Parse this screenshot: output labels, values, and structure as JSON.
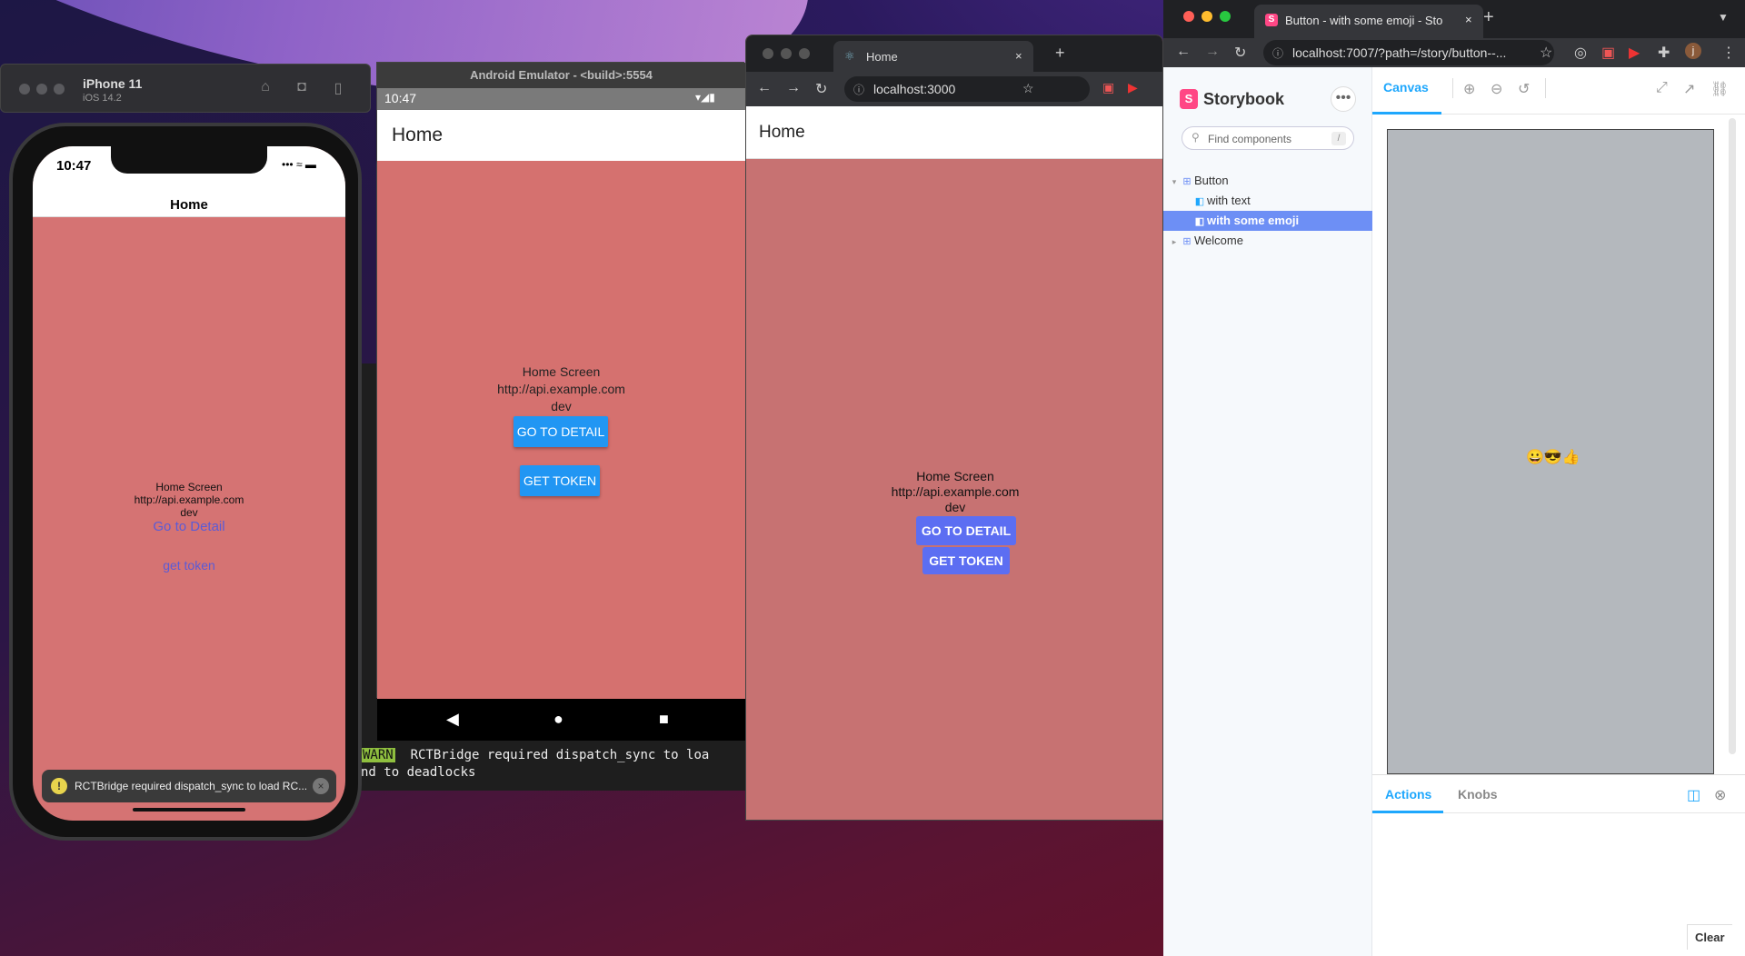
{
  "ios_sim": {
    "device_name": "iPhone 11",
    "os_version": "iOS 14.2",
    "time": "10:47",
    "status_icons": "••• ≈ ▬",
    "nav_title": "Home",
    "screen_title": "Home Screen",
    "api_url": "http://api.example.com",
    "env": "dev",
    "link_detail": "Go to Detail",
    "link_token": "get token",
    "warning": "RCTBridge required dispatch_sync to load RC..."
  },
  "terminal": {
    "lines": [
      "WARN",
      "  RCTBridge required dispatch_sync to loa",
      "nd to deadlocks"
    ]
  },
  "android": {
    "window_title": "Android Emulator - <build>:5554",
    "time": "10:47",
    "bar_title": "Home",
    "screen_title": "Home Screen",
    "api_url": "http://api.example.com",
    "env": "dev",
    "btn_detail": "GO TO DETAIL",
    "btn_token": "GET TOKEN"
  },
  "web": {
    "tab_title": "Home",
    "url": "localhost:3000",
    "bar_title": "Home",
    "screen_title": "Home Screen",
    "api_url": "http://api.example.com",
    "env": "dev",
    "btn_detail": "GO TO DETAIL",
    "btn_token": "GET TOKEN"
  },
  "storybook": {
    "tab_title": "Button - with some emoji - Sto",
    "url": "localhost:7007/?path=/story/button--...",
    "brand": "Storybook",
    "search_placeholder": "Find components",
    "search_shortcut": "/",
    "tree": [
      {
        "label": "Button",
        "level": 0
      },
      {
        "label": "with text",
        "level": 1
      },
      {
        "label": "with some emoji",
        "level": 1,
        "selected": true
      },
      {
        "label": "Welcome",
        "level": 0
      }
    ],
    "canvas_tab": "Canvas",
    "preview_emoji": "😀😎👍",
    "addon_tabs": [
      "Actions",
      "Knobs"
    ],
    "clear_label": "Clear"
  },
  "colors": {
    "screen_bg": "#d57373",
    "android_btn": "#2196f3",
    "web_btn": "#5c6ef2",
    "sb_accent": "#1ea7fd",
    "sb_selected": "#6d8ff5"
  }
}
